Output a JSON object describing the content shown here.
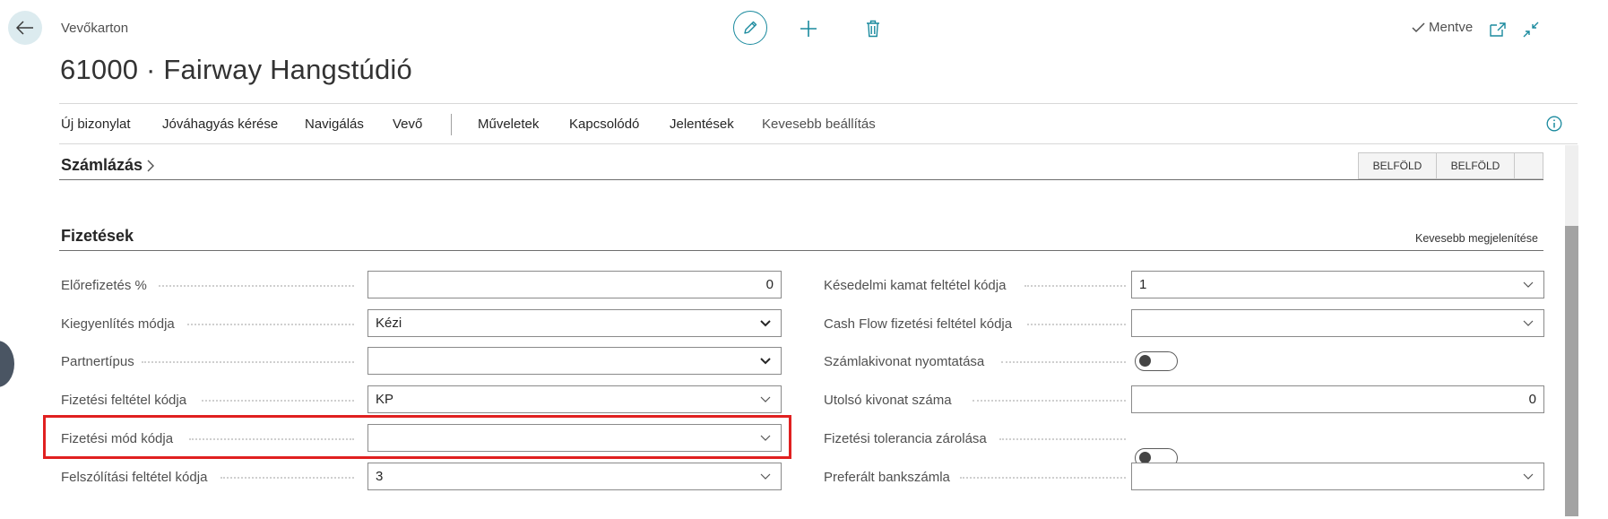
{
  "header": {
    "caption": "Vevőkarton",
    "title": "61000 · Fairway Hangstúdió",
    "saved_label": "Mentve"
  },
  "icons": {
    "back": "back-arrow-icon",
    "edit": "pencil-icon",
    "new": "plus-icon",
    "delete": "trash-icon",
    "open_new": "open-in-new-window-icon",
    "collapse": "collapse-icon",
    "info": "info-icon",
    "saved": "checkmark-icon"
  },
  "menu": {
    "items": [
      "Új bizonylat",
      "Jóváhagyás kérése",
      "Navigálás",
      "Vevő",
      "Műveletek",
      "Kapcsolódó",
      "Jelentések",
      "Kevesebb beállítás"
    ]
  },
  "billing": {
    "title": "Számlázás",
    "tags": [
      "BELFÖLD",
      "BELFÖLD"
    ]
  },
  "payments": {
    "title": "Fizetések",
    "show_less": "Kevesebb megjelenítése",
    "left": [
      {
        "label": "Előrefizetés %",
        "value": "0"
      },
      {
        "label": "Kiegyenlítés módja",
        "value": "Kézi"
      },
      {
        "label": "Partnertípus",
        "value": ""
      },
      {
        "label": "Fizetési feltétel kódja",
        "value": "KP"
      },
      {
        "label": "Fizetési mód kódja",
        "value": ""
      },
      {
        "label": "Felszólítási feltétel kódja",
        "value": "3"
      }
    ],
    "right": [
      {
        "label": "Késedelmi kamat feltétel kódja",
        "value": "1"
      },
      {
        "label": "Cash Flow fizetési feltétel kódja",
        "value": ""
      },
      {
        "label": "Számlakivonat nyomtatása",
        "value": false
      },
      {
        "label": "Utolsó kivonat száma",
        "value": "0"
      },
      {
        "label": "Fizetési tolerancia zárolása",
        "value": false
      },
      {
        "label": "Preferált bankszámla",
        "value": ""
      }
    ]
  },
  "colors": {
    "accent": "#1a8a9e",
    "highlight": "#e02020"
  }
}
